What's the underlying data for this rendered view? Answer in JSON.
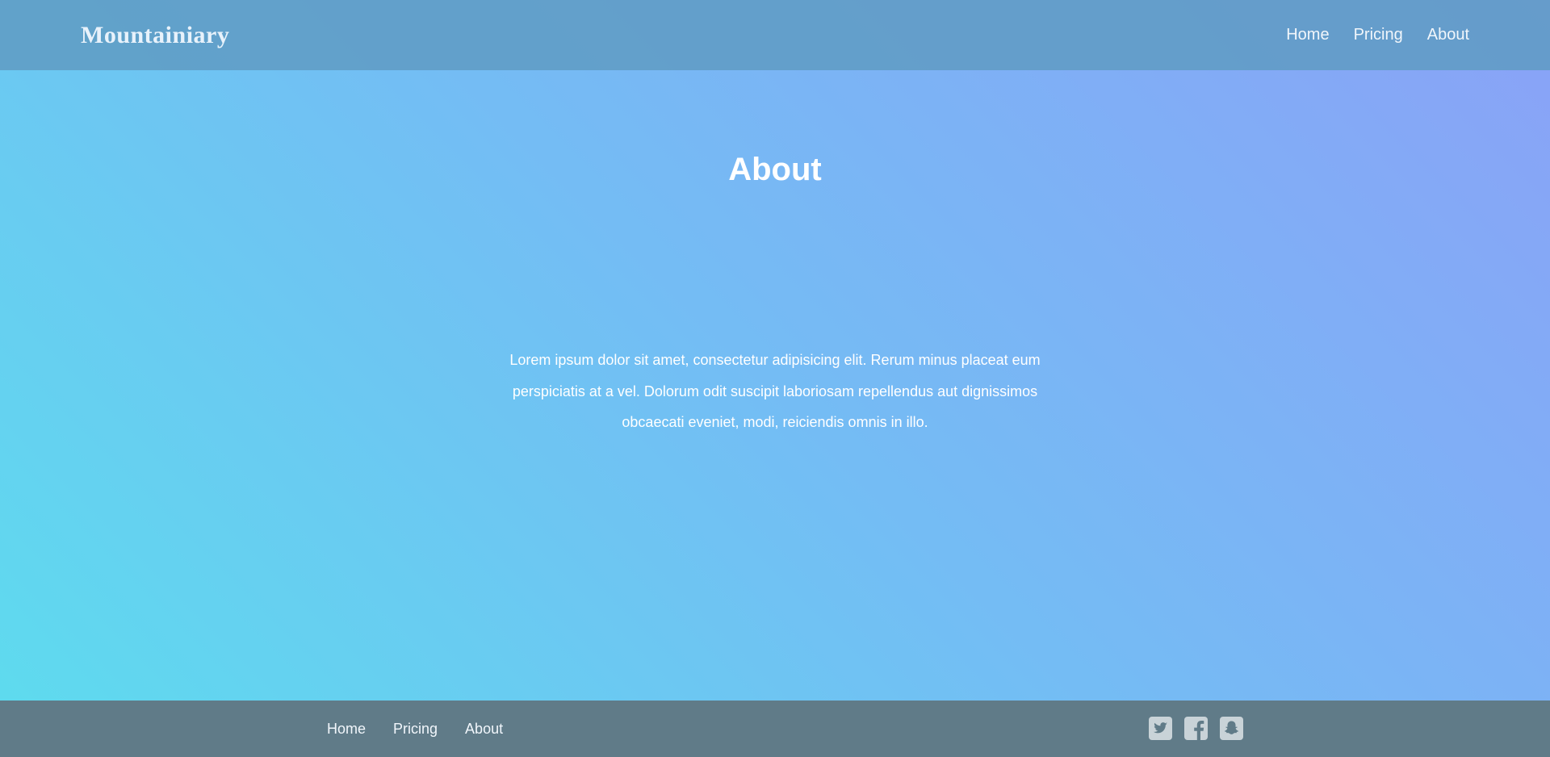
{
  "header": {
    "logo": "Mountainiary",
    "nav": [
      {
        "label": "Home"
      },
      {
        "label": "Pricing"
      },
      {
        "label": "About"
      }
    ]
  },
  "hero": {
    "title": "About",
    "text": "Lorem ipsum dolor sit amet, consectetur adipisicing elit. Rerum minus placeat eum perspiciatis at a vel. Dolorum odit suscipit laboriosam repellendus aut dignissimos obcaecati eveniet, modi, reiciendis omnis in illo."
  },
  "footer": {
    "nav": [
      {
        "label": "Home"
      },
      {
        "label": "Pricing"
      },
      {
        "label": "About"
      }
    ],
    "social": [
      {
        "icon": "twitter-icon"
      },
      {
        "icon": "facebook-icon"
      },
      {
        "icon": "snapchat-icon"
      }
    ]
  },
  "colors": {
    "gradient_start": "#5ddcee",
    "gradient_mid": "#74bcf4",
    "gradient_end": "#8aa2f7",
    "header_bg": "#5f9bc3",
    "footer_bg": "#607b88",
    "icon_color": "#c9d3d8"
  }
}
